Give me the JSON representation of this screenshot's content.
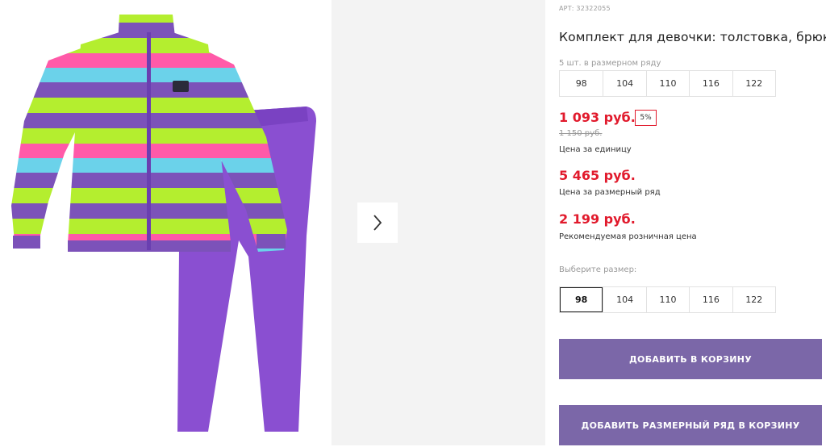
{
  "product": {
    "article": "АРТ: 32322055",
    "title": "Комплект для девочки: толстовка, брюки"
  },
  "size_row": {
    "note": "5 шт. в размерном ряду",
    "sizes": [
      "98",
      "104",
      "110",
      "116",
      "122"
    ]
  },
  "prices": {
    "unit_price": "1 093 руб.",
    "discount": "5%",
    "old_price": "1 150 руб.",
    "unit_label": "Цена за единицу",
    "row_price": "5 465 руб.",
    "row_label": "Цена за размерный ряд",
    "retail_price": "2 199 руб.",
    "retail_label": "Рекомендуемая розничная цена",
    "accent_color": "#e11a2c"
  },
  "size_select": {
    "label": "Выберите размер:",
    "sizes": [
      "98",
      "104",
      "110",
      "116",
      "122"
    ],
    "selected": "98"
  },
  "actions": {
    "add_to_cart": "ДОБАВИТЬ В КОРЗИНУ",
    "add_row_to_cart": "ДОБАВИТЬ РАЗМЕРНЫЙ РЯД В КОРЗИНУ",
    "button_color": "#7b67a8"
  },
  "gallery": {
    "next_icon": "chevron-right-icon"
  }
}
